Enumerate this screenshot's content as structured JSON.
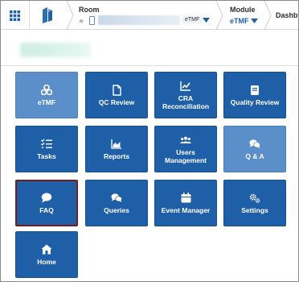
{
  "header": {
    "room_label": "Room",
    "room_tag": "eTMF",
    "module_label": "Module",
    "module_value": "eTMF",
    "dashboard_label": "Dashb"
  },
  "tiles": [
    {
      "label": "eTMF",
      "icon": "cubes-icon"
    },
    {
      "label": "QC Review",
      "icon": "document-icon"
    },
    {
      "label": "CRA Reconciliation",
      "icon": "line-chart-icon"
    },
    {
      "label": "Quality Review",
      "icon": "book-icon"
    },
    {
      "label": "Tasks",
      "icon": "checklist-icon"
    },
    {
      "label": "Reports",
      "icon": "area-chart-icon"
    },
    {
      "label": "Users Management",
      "icon": "users-icon"
    },
    {
      "label": "Q & A",
      "icon": "chat-bubbles-icon"
    },
    {
      "label": "FAQ",
      "icon": "speech-bubble-icon"
    },
    {
      "label": "Queries",
      "icon": "chat-bubbles-icon"
    },
    {
      "label": "Event Manager",
      "icon": "calendar-icon"
    },
    {
      "label": "Settings",
      "icon": "gears-icon"
    },
    {
      "label": "Home",
      "icon": "home-icon"
    }
  ],
  "colors": {
    "tile": "#1f5fa8",
    "tile_light": "#5b8fc9",
    "faq_outline": "#7b1a1a"
  }
}
